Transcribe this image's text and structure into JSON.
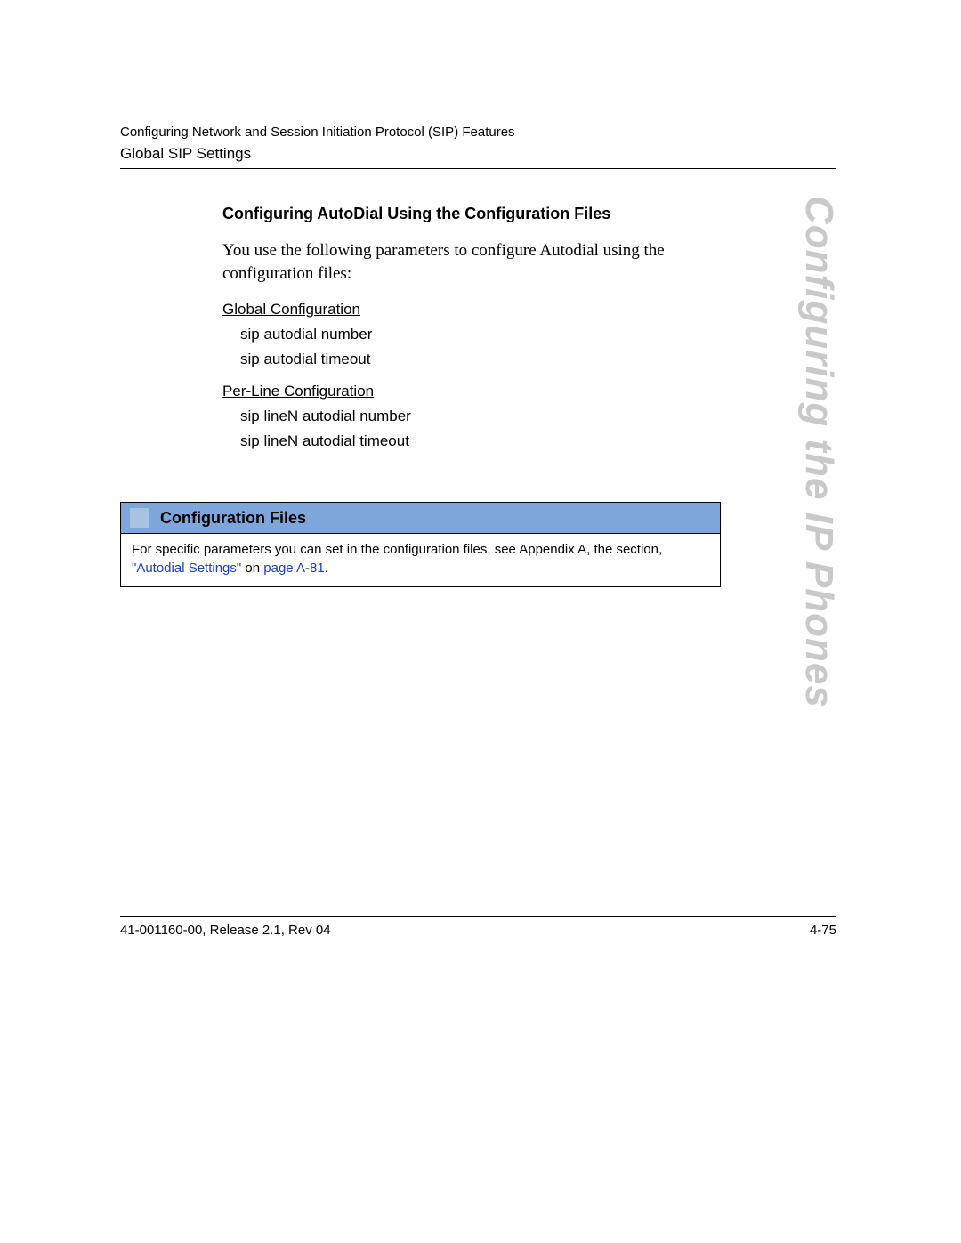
{
  "header": {
    "breadcrumb": "Configuring Network and Session Initiation Protocol (SIP) Features",
    "section": "Global SIP Settings"
  },
  "watermark": "Configuring the IP Phones",
  "content": {
    "heading": "Configuring AutoDial Using the Configuration Files",
    "intro": "You use the following parameters to configure Autodial using the configuration files:",
    "global_label": "Global Configuration",
    "global_params": [
      "sip autodial number",
      "sip autodial timeout"
    ],
    "perline_label": "Per-Line Configuration",
    "perline_params": [
      "sip lineN autodial number",
      "sip lineN autodial timeout"
    ]
  },
  "box": {
    "title": "Configuration Files",
    "body_prefix": "For specific parameters you can set in the configuration files, see Appendix A, the section, ",
    "link1": "\"Autodial Settings\"",
    "body_mid": " on ",
    "link2": "page A-81",
    "body_suffix": "."
  },
  "footer": {
    "left": "41-001160-00, Release 2.1, Rev 04",
    "right": "4-75"
  }
}
